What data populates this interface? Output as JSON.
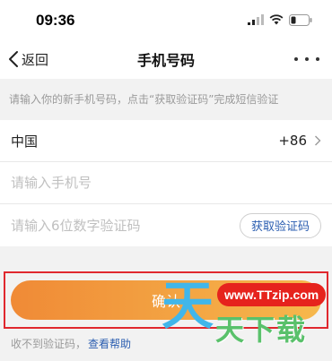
{
  "status_bar": {
    "time": "09:36"
  },
  "nav": {
    "back_label": "返回",
    "title": "手机号码"
  },
  "hint": "请输入你的新手机号码，点击“获取验证码”完成短信验证",
  "country": {
    "name": "中国",
    "code": "+86"
  },
  "phone_input": {
    "placeholder": "请输入手机号",
    "value": ""
  },
  "code_input": {
    "placeholder": "请输入6位数字验证码",
    "value": ""
  },
  "get_code_label": "获取验证码",
  "confirm_label": "确认",
  "help": {
    "text": "收不到验证码，",
    "link": "查看帮助"
  },
  "watermark": {
    "url": "www.TTzip.com",
    "big": "天",
    "sub": "天下载"
  },
  "colors": {
    "button_start": "#f08a36",
    "button_end": "#f6b84c",
    "link": "#2a5db0",
    "highlight": "#e0282e"
  }
}
